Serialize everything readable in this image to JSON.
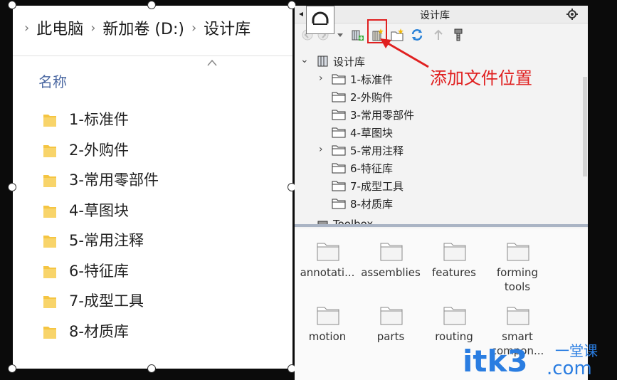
{
  "explorer": {
    "breadcrumb": [
      "此电脑",
      "新加卷 (D:)",
      "设计库"
    ],
    "column_header": "名称",
    "items": [
      "1-标准件",
      "2-外购件",
      "3-常用零部件",
      "4-草图块",
      "5-常用注释",
      "6-特征库",
      "7-成型工具",
      "8-材质库"
    ]
  },
  "library": {
    "title": "设计库",
    "tree": {
      "root": "设计库",
      "children": [
        "1-标准件",
        "2-外购件",
        "3-常用零部件",
        "4-草图块",
        "5-常用注释",
        "6-特征库",
        "7-成型工具",
        "8-材质库"
      ],
      "next_partial": "Toolbox"
    },
    "grid": [
      "annotati...",
      "assemblies",
      "features",
      "forming tools",
      "motion",
      "parts",
      "routing",
      "smart compon..."
    ]
  },
  "annotation": {
    "text": "添加文件位置"
  },
  "watermark": {
    "text": "itk3",
    "suffix": ".com",
    "cn": "一堂课"
  },
  "colors": {
    "highlight": "#e02020",
    "folder_yellow": "#f5c542",
    "watermark_blue": "#2a7de1"
  }
}
